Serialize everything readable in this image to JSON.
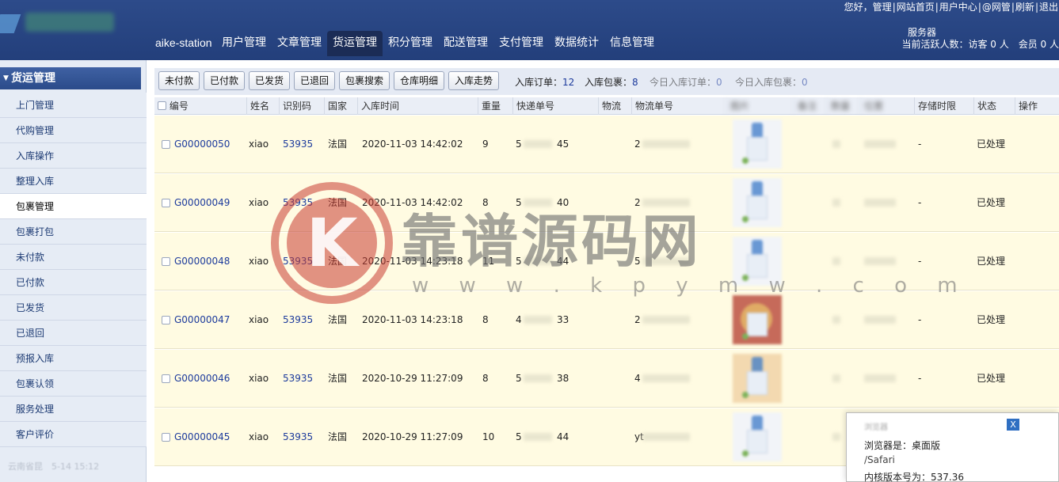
{
  "header": {
    "brand": "aike-station",
    "nav": [
      "用户管理",
      "文章管理",
      "货运管理",
      "积分管理",
      "配送管理",
      "支付管理",
      "数据统计",
      "信息管理"
    ],
    "nav_active": "货运管理",
    "greeting": "您好，管理",
    "top_links": [
      "网站首页",
      "用户中心",
      "@网管",
      "刷新",
      "退出"
    ],
    "server_label": "服务器",
    "online_text": "当前活跃人数：访客 0 人　会员 0 人"
  },
  "sidebar": {
    "section_title": "货运管理",
    "items": [
      "上门管理",
      "代购管理",
      "入库操作",
      "整理入库",
      "包裹管理",
      "包裹打包",
      "未付款",
      "已付款",
      "已发货",
      "已退回",
      "预报入库",
      "包裹认领",
      "服务处理",
      "客户评价"
    ],
    "active_item": "包裹管理",
    "footer": "云南省昆　5-14 15:12"
  },
  "toolbar": {
    "buttons": [
      "未付款",
      "已付款",
      "已发货",
      "已退回",
      "包裹搜索",
      "仓库明细",
      "入库走势"
    ],
    "stats": [
      {
        "label": "入库订单：",
        "value": "12"
      },
      {
        "label": "入库包裹：",
        "value": "8"
      },
      {
        "label": "今日入库订单：",
        "value": "0"
      },
      {
        "label": "今日入库包裹：",
        "value": "0"
      }
    ]
  },
  "table": {
    "columns": [
      "编号",
      "姓名",
      "识别码",
      "国家",
      "入库时间",
      "重量",
      "快递单号",
      "物流",
      "物流单号",
      "图片",
      "备注",
      "数量",
      "位置",
      "存储时限",
      "状态",
      "操作"
    ],
    "rows": [
      {
        "id": "G00000050",
        "name": "xiao",
        "code": "53935",
        "country": "法国",
        "time": "2020-11-03 14:42:02",
        "weight": "9",
        "tracking_start": "5",
        "tracking_end": "45",
        "logistics_start": "2",
        "storage": "-",
        "status": "已处理"
      },
      {
        "id": "G00000049",
        "name": "xiao",
        "code": "53935",
        "country": "法国",
        "time": "2020-11-03 14:42:02",
        "weight": "8",
        "tracking_start": "5",
        "tracking_end": "40",
        "logistics_start": "2",
        "storage": "-",
        "status": "已处理"
      },
      {
        "id": "G00000048",
        "name": "xiao",
        "code": "53935",
        "country": "法国",
        "time": "2020-11-03 14:23:18",
        "weight": "11",
        "tracking_start": "5",
        "tracking_end": "44",
        "logistics_start": "5",
        "storage": "-",
        "status": "已处理"
      },
      {
        "id": "G00000047",
        "name": "xiao",
        "code": "53935",
        "country": "法国",
        "time": "2020-11-03 14:23:18",
        "weight": "8",
        "tracking_start": "4",
        "tracking_end": "33",
        "logistics_start": "2",
        "storage": "-",
        "status": "已处理"
      },
      {
        "id": "G00000046",
        "name": "xiao",
        "code": "53935",
        "country": "法国",
        "time": "2020-10-29 11:27:09",
        "weight": "8",
        "tracking_start": "5",
        "tracking_end": "38",
        "logistics_start": "4",
        "storage": "-",
        "status": "已处理"
      },
      {
        "id": "G00000045",
        "name": "xiao",
        "code": "53935",
        "country": "法国",
        "time": "2020-10-29 11:27:09",
        "weight": "10",
        "tracking_start": "5",
        "tracking_end": "44",
        "logistics_start": "yt",
        "storage": "-",
        "status": "已处理"
      }
    ]
  },
  "info_popup": {
    "close_label": "X",
    "line1": "浏览器",
    "browser_line": "浏览器是：桌面版",
    "engine_line": "/Safari",
    "version_line": "内核版本号为：537.36"
  },
  "watermark": {
    "logo_letter": "K",
    "title": "靠谱源码网",
    "url": "w w w . k p y m w . c o m"
  },
  "colors": {
    "header_bg": "#2d4b8a",
    "nav_active_bg": "#1b2c56",
    "sidebar_bg": "#e6ecf5",
    "row_bg": "#fffbe2",
    "link": "#1c3a9c"
  }
}
